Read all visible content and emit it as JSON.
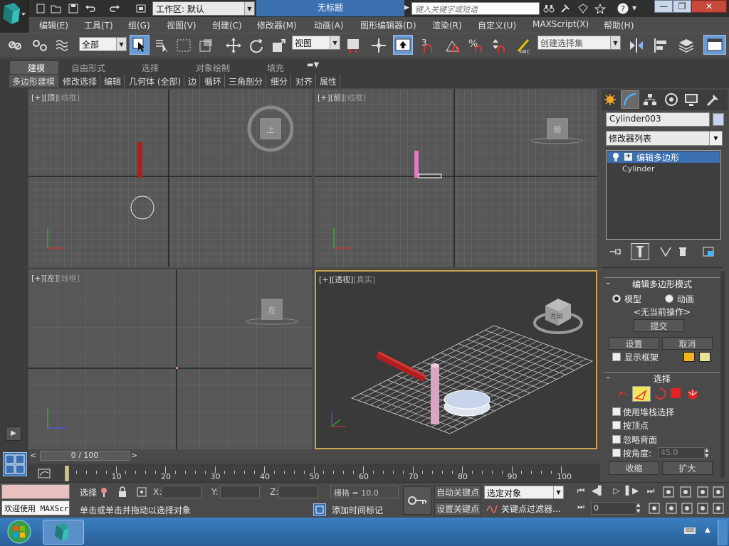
{
  "titlebar": {
    "workspace_label": "工作区: 默认",
    "doc_title": "无标题",
    "search_placeholder": "键入关键字或短语"
  },
  "menu": [
    "编辑(E)",
    "工具(T)",
    "组(G)",
    "视图(V)",
    "创建(C)",
    "修改器(M)",
    "动画(A)",
    "图形编辑器(D)",
    "渲染(R)",
    "自定义(U)",
    "MAXScript(X)",
    "帮助(H)"
  ],
  "toolbar": {
    "selection_filter": "全部",
    "ref_coord": "视图",
    "snap_angle_label": "3",
    "named_selection": "创建选择集"
  },
  "ribbon": {
    "tabs": [
      "建模",
      "自由形式",
      "选择",
      "对象绘制",
      "填充"
    ],
    "subtabs": [
      "多边形建模",
      "修改选择",
      "编辑",
      "几何体 (全部)",
      "边",
      "循环",
      "三角剖分",
      "细分",
      "对齐",
      "属性"
    ]
  },
  "viewports": {
    "top_label": {
      "a": "[+]",
      "b": "[顶]",
      "c": "[线框]"
    },
    "front_label": {
      "a": "[+]",
      "b": "[前]",
      "c": "[线框]"
    },
    "left_label": {
      "a": "[+]",
      "b": "[左]",
      "c": "[线框]"
    },
    "persp_label": {
      "a": "[+]",
      "b": "[透视]",
      "c": "[真实]"
    },
    "cube_labels": {
      "top": "上",
      "front": "前",
      "left": "左",
      "persp": "左前"
    }
  },
  "command_panel": {
    "object_name": "Cylinder003",
    "modifier_list": "修改器列表",
    "stack": [
      "编辑多边形",
      "Cylinder"
    ],
    "edit_poly_mode": {
      "title": "编辑多边形模式",
      "model": "模型",
      "animate": "动画",
      "no_current": "<无当前操作>",
      "commit": "提交",
      "settings": "设置",
      "cancel": "取消",
      "show_cage": "显示框架"
    },
    "selection": {
      "title": "选择",
      "use_stack": "使用堆栈选择",
      "by_vertex": "按顶点",
      "ignore_backfacing": "忽略背面",
      "by_angle": "按角度:",
      "angle_value": "45.0",
      "shrink": "收缩",
      "grow": "扩大"
    }
  },
  "timeline": {
    "frame": "0 / 100",
    "ticks": [
      "10",
      "20",
      "30",
      "40",
      "50",
      "60",
      "70",
      "80",
      "90",
      "100"
    ]
  },
  "status": {
    "maxscript_text": "欢迎使用 MAXScr",
    "selected_label": "选择",
    "x_label": "X:",
    "y_label": "Y:",
    "z_label": "Z:",
    "grid": "栅格 = 10.0",
    "prompt": "单击或单击并拖动以选择对象",
    "add_time_tag": "添加时间标记",
    "auto_key": "自动关键点",
    "set_key": "设置关键点",
    "key_mode": "选定对象",
    "key_filters": "关键点过滤器...",
    "frame_value": "0"
  },
  "colors": {
    "accent": "#3a6fb0",
    "red_object": "#b01e1e",
    "pink_object": "#e07ac8",
    "viewport_bg": "#575757",
    "active_border": "#c9a24a"
  }
}
